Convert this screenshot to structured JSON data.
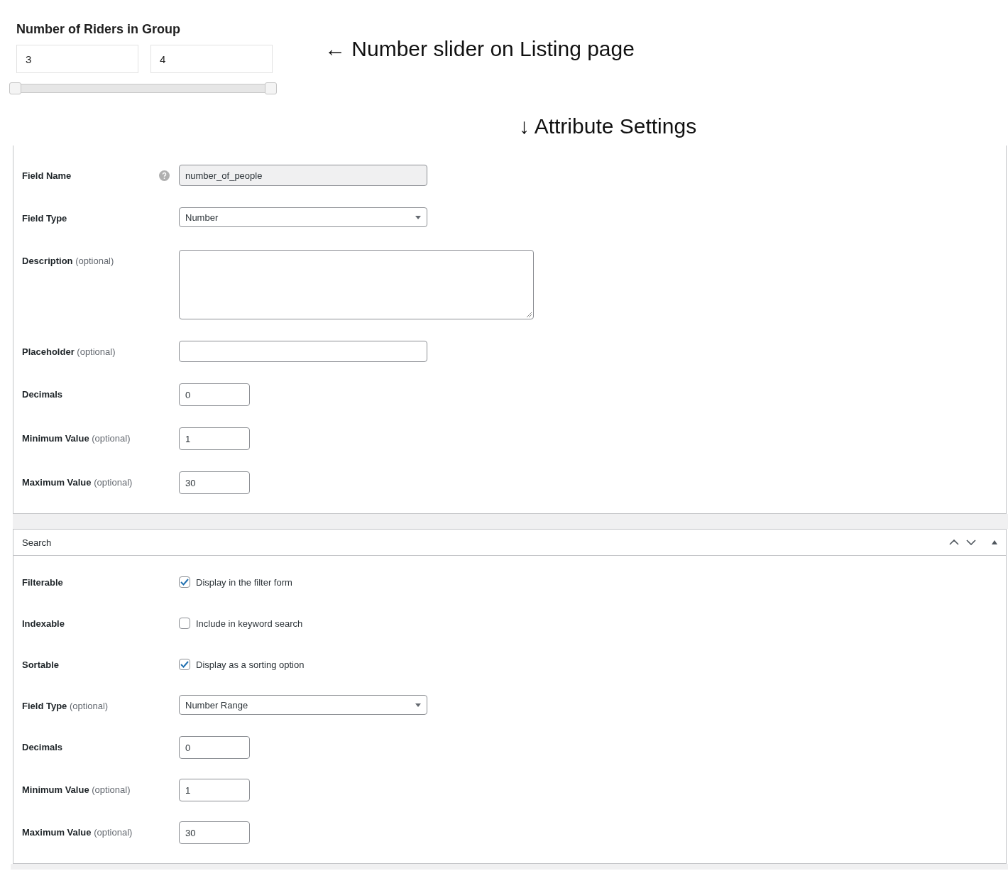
{
  "listing_preview": {
    "title": "Number of Riders in Group",
    "inputs": [
      {
        "value": "3"
      },
      {
        "value": "4"
      }
    ],
    "slider": {
      "thumbs": [
        {
          "level": 0
        },
        {
          "level": 1
        }
      ]
    }
  },
  "annotations": [
    {
      "arrow": "←",
      "text": "Number slider on Listing page"
    },
    {
      "arrow": "↓",
      "text": "Attribute Settings"
    }
  ],
  "settings_fields": [
    {
      "kind": "readonly",
      "label": "Field Name",
      "value": "number_of_people"
    },
    {
      "kind": "select",
      "label": "Field Type",
      "value": "Number"
    },
    {
      "kind": "textarea",
      "label": "Description",
      "optional": "(optional)"
    },
    {
      "kind": "text",
      "label": "Placeholder",
      "optional": "(optional)"
    },
    {
      "kind": "number",
      "label": "Decimals",
      "value": "0"
    },
    {
      "kind": "number",
      "label": "Minimum Value",
      "optional": "(optional)",
      "value": "1"
    },
    {
      "kind": "number",
      "label": "Maximum Value",
      "optional": "(optional)",
      "value": "30"
    }
  ],
  "search_panel": {
    "title": "Search",
    "fields": [
      {
        "kind": "checkbox",
        "label": "Filterable",
        "checked": true,
        "text": "Display in the filter form"
      },
      {
        "kind": "checkbox",
        "label": "Indexable",
        "checked": false,
        "text": "Include in keyword search"
      },
      {
        "kind": "checkbox",
        "label": "Sortable",
        "checked": true,
        "text": "Display as a sorting option"
      },
      {
        "kind": "select",
        "label": "Field Type",
        "optional": "(optional)",
        "value": "Number Range"
      },
      {
        "kind": "number",
        "label": "Decimals",
        "value": "0"
      },
      {
        "kind": "number",
        "label": "Minimum Value",
        "optional": "(optional)",
        "value": "1"
      },
      {
        "kind": "number",
        "label": "Maximum Value",
        "optional": "(optional)",
        "value": "30"
      }
    ]
  }
}
